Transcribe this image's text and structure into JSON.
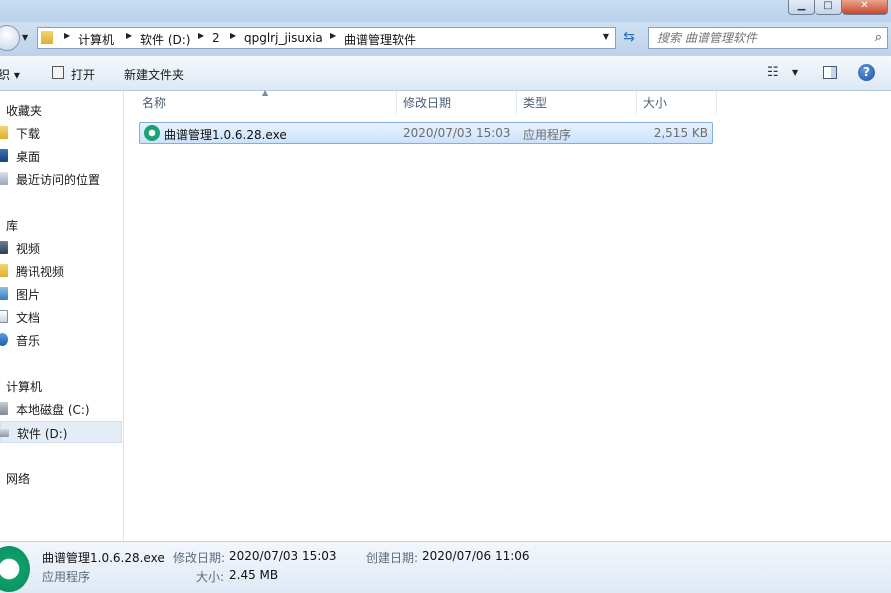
{
  "address": {
    "breadcrumbs": [
      "计算机",
      "软件 (D:)",
      "2",
      "qpglrj_jisuxia",
      "曲谱管理软件"
    ]
  },
  "search": {
    "placeholder": "搜索 曲谱管理软件"
  },
  "toolbar": {
    "organize_label": "织 ▾",
    "open_label": "打开",
    "new_folder_label": "新建文件夹"
  },
  "nav": {
    "favorites": {
      "label": "收藏夹",
      "items": [
        "下载",
        "桌面",
        "最近访问的位置"
      ]
    },
    "libraries": {
      "label": "库",
      "items": [
        "视频",
        "腾讯视频",
        "图片",
        "文档",
        "音乐"
      ]
    },
    "computer": {
      "label": "计算机",
      "items": [
        "本地磁盘 (C:)",
        "软件 (D:)"
      ]
    },
    "network": {
      "label": "网络"
    }
  },
  "file_list": {
    "columns": [
      "名称",
      "修改日期",
      "类型",
      "大小"
    ],
    "rows": [
      {
        "name": "曲谱管理1.0.6.28.exe",
        "modified": "2020/07/03 15:03",
        "type": "应用程序",
        "size": "2,515 KB"
      }
    ]
  },
  "details": {
    "name": "曲谱管理1.0.6.28.exe",
    "type": "应用程序",
    "modified_label": "修改日期:",
    "modified_value": "2020/07/03 15:03",
    "size_label": "大小:",
    "size_value": "2.45 MB",
    "created_label": "创建日期:",
    "created_value": "2020/07/06 11:06"
  },
  "icons": {
    "file_icon": "headphones-app-icon",
    "accent_green": "#19a374"
  }
}
